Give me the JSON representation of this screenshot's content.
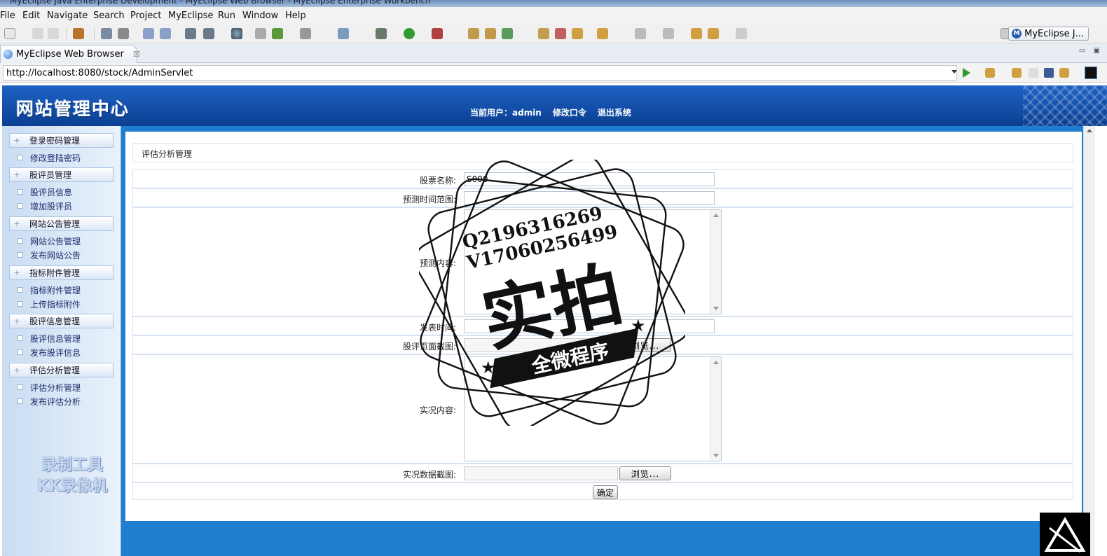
{
  "window": {
    "title": "MyEclipse Java Enterprise Development - MyEclipse Web Browser - MyEclipse Enterprise Workbench"
  },
  "menu": [
    "File",
    "Edit",
    "Navigate",
    "Search",
    "Project",
    "MyEclipse",
    "Run",
    "Window",
    "Help"
  ],
  "perspective": {
    "label": "MyEclipse J..."
  },
  "tab": {
    "label": "MyEclipse Web Browser",
    "close": "☒"
  },
  "browser": {
    "url": "http://localhost:8080/stock/AdminServlet"
  },
  "site": {
    "logo": "网站管理中心",
    "current_user": "当前用户：admin",
    "change_password": "修改口令",
    "logout": "退出系统"
  },
  "sidebar": {
    "groups": [
      {
        "label": "登录密码管理",
        "items": [
          "修改登陆密码"
        ]
      },
      {
        "label": "股评员管理",
        "items": [
          "股评员信息",
          "增加股评员"
        ]
      },
      {
        "label": "网站公告管理",
        "items": [
          "网站公告管理",
          "发布网站公告"
        ]
      },
      {
        "label": "指标附件管理",
        "items": [
          "指标附件管理",
          "上传指标附件"
        ]
      },
      {
        "label": "股评信息管理",
        "items": [
          "股评信息管理",
          "发布股评信息"
        ]
      },
      {
        "label": "评估分析管理",
        "items": [
          "评估分析管理",
          "发布评估分析"
        ]
      }
    ]
  },
  "panel": {
    "title": "评估分析管理"
  },
  "form": {
    "stock_name_label": "股票名称:",
    "stock_name_value": "S000",
    "forecast_range_label": "预测时间范围:",
    "forecast_range_value": "",
    "forecast_content_label": "预测内容:",
    "publish_time_label": "发表时间:",
    "publish_time_value": "",
    "review_screenshot_label": "股评页面截图:",
    "actual_content_label": "实况内容:",
    "actual_data_label": "实况数据截图:",
    "browse_label": "浏览...",
    "submit_label": "确定"
  },
  "watermarks": {
    "left_line1": "录制工具",
    "left_line2": "KK录像机",
    "stamp_qq": "Q2196316269",
    "stamp_v": "V17060256499",
    "stamp_main": "实拍",
    "stamp_banner": "全微程序"
  },
  "colors": {
    "header_blue": "#0a3f92",
    "frame_blue": "#1f7ed0",
    "sidebar_bg": "#c9dcf2"
  }
}
